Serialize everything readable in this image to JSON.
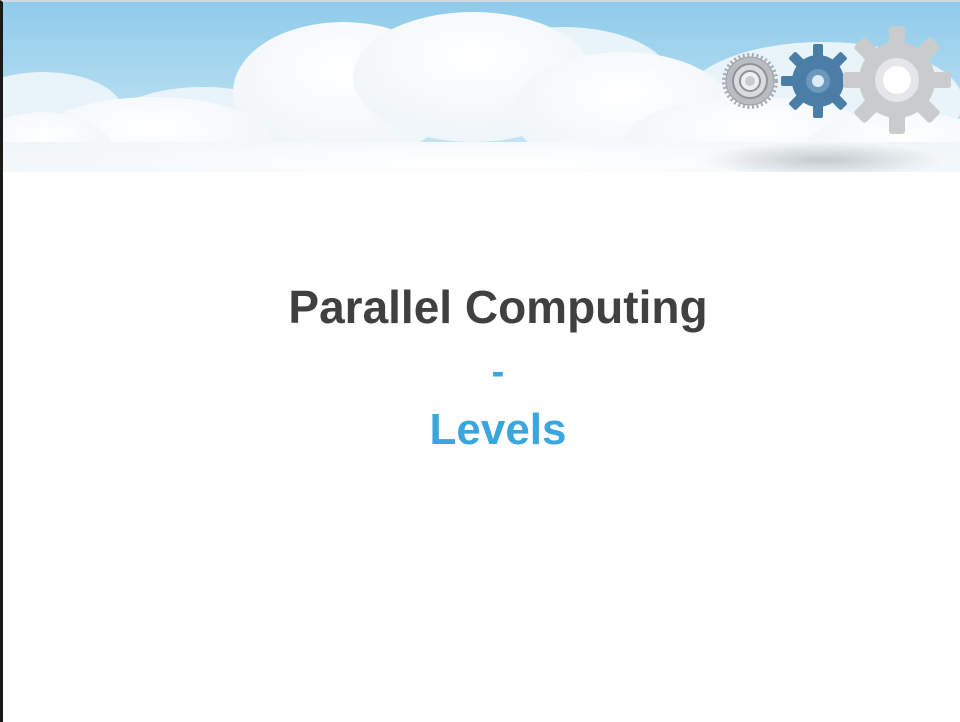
{
  "slide": {
    "title": "Parallel Computing",
    "separator": "-",
    "subtitle": "Levels"
  },
  "colors": {
    "title": "#404040",
    "accent": "#3aa6dd",
    "sky": "#bfe0f2"
  },
  "decorations": {
    "banner": "clouds-banner",
    "icons": [
      "small-gear-icon",
      "blue-gear-icon",
      "large-gear-icon"
    ]
  }
}
